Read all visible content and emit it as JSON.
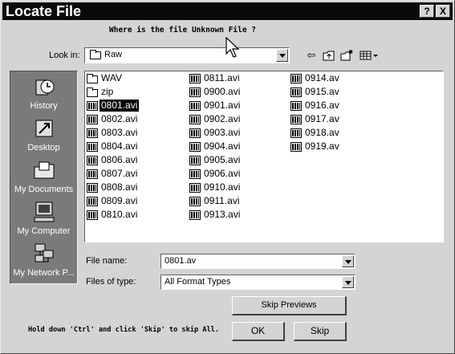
{
  "window": {
    "title": "Locate File",
    "help_label": "?",
    "close_label": "X"
  },
  "prompt": "Where is the file Unknown File ?",
  "look_in": {
    "label": "Look in:",
    "value": "Raw"
  },
  "places": [
    {
      "key": "history",
      "label": "History"
    },
    {
      "key": "desktop",
      "label": "Desktop"
    },
    {
      "key": "documents",
      "label": "My Documents"
    },
    {
      "key": "computer",
      "label": "My Computer"
    },
    {
      "key": "network",
      "label": "My Network P..."
    }
  ],
  "files": {
    "col1": [
      {
        "name": "WAV",
        "type": "folder"
      },
      {
        "name": "zip",
        "type": "folder"
      },
      {
        "name": "0801.avi",
        "type": "avi",
        "selected": true
      },
      {
        "name": "0802.avi",
        "type": "avi"
      },
      {
        "name": "0803.avi",
        "type": "avi"
      },
      {
        "name": "0804.avi",
        "type": "avi"
      },
      {
        "name": "0806.avi",
        "type": "avi"
      },
      {
        "name": "0807.avi",
        "type": "avi"
      },
      {
        "name": "0808.avi",
        "type": "avi"
      },
      {
        "name": "0809.avi",
        "type": "avi"
      },
      {
        "name": "0810.avi",
        "type": "avi"
      }
    ],
    "col2": [
      {
        "name": "0811.avi",
        "type": "avi"
      },
      {
        "name": "0900.avi",
        "type": "avi"
      },
      {
        "name": "0901.avi",
        "type": "avi"
      },
      {
        "name": "0902.avi",
        "type": "avi"
      },
      {
        "name": "0903.avi",
        "type": "avi"
      },
      {
        "name": "0904.avi",
        "type": "avi"
      },
      {
        "name": "0905.avi",
        "type": "avi"
      },
      {
        "name": "0906.avi",
        "type": "avi"
      },
      {
        "name": "0910.avi",
        "type": "avi"
      },
      {
        "name": "0911.avi",
        "type": "avi"
      },
      {
        "name": "0913.avi",
        "type": "avi"
      }
    ],
    "col3": [
      {
        "name": "0914.av",
        "type": "avi"
      },
      {
        "name": "0915.av",
        "type": "avi"
      },
      {
        "name": "0916.av",
        "type": "avi"
      },
      {
        "name": "0917.av",
        "type": "avi"
      },
      {
        "name": "0918.av",
        "type": "avi"
      },
      {
        "name": "0919.av",
        "type": "avi"
      }
    ]
  },
  "file_name": {
    "label": "File name:",
    "value": "0801.av"
  },
  "file_type": {
    "label": "Files of type:",
    "value": "All Format Types"
  },
  "buttons": {
    "skip_previews": "Skip Previews",
    "ok": "OK",
    "skip": "Skip"
  },
  "hint": "Hold down 'Ctrl' and click 'Skip' to skip All.",
  "toolbar_icons": [
    "back-icon",
    "up-folder-icon",
    "new-folder-icon",
    "view-menu-icon"
  ]
}
